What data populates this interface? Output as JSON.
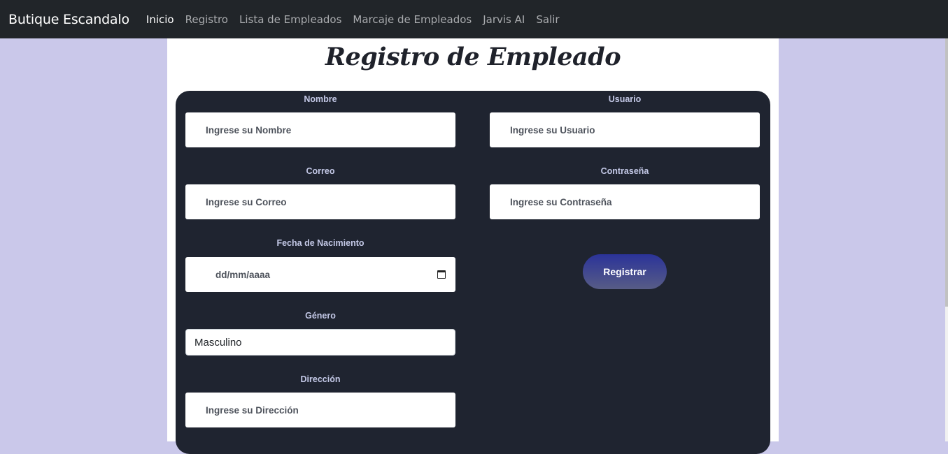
{
  "navbar": {
    "brand": "Butique Escandalo",
    "links": [
      "Inicio",
      "Registro",
      "Lista de Empleados",
      "Marcaje de Empleados",
      "Jarvis AI",
      "Salir"
    ]
  },
  "page": {
    "title": "Registro de Empleado"
  },
  "form": {
    "nombre": {
      "label": "Nombre",
      "placeholder": "Ingrese su Nombre"
    },
    "usuario": {
      "label": "Usuario",
      "placeholder": "Ingrese su Usuario"
    },
    "correo": {
      "label": "Correo",
      "placeholder": "Ingrese su Correo"
    },
    "contrasena": {
      "label": "Contraseña",
      "placeholder": "Ingrese su Contraseña"
    },
    "fecha": {
      "label": "Fecha de Nacimiento",
      "placeholder": "dd/mm/aaaa"
    },
    "genero": {
      "label": "Género",
      "value": "Masculino"
    },
    "direccion": {
      "label": "Dirección",
      "placeholder": "Ingrese su Dirección"
    },
    "submit_label": "Registrar"
  },
  "icons": {
    "date_picker": "calendar-icon"
  },
  "colors": {
    "navbar_bg": "#212529",
    "page_bg": "#cac8ea",
    "form_bg": "#1f2430",
    "label_color": "#c3c8e6",
    "button_gradient_top": "#2b3399",
    "button_gradient_bottom": "#575c86"
  }
}
